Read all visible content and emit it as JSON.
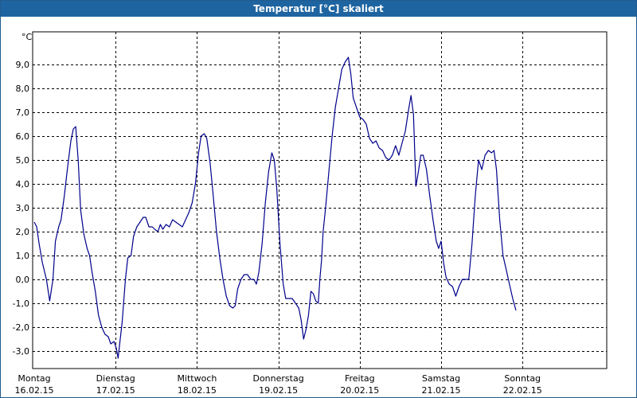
{
  "window": {
    "title": "Temperatur [°C] skaliert"
  },
  "chart_data": {
    "type": "line",
    "title": "Temperatur [°C] skaliert",
    "unit_label": "°C",
    "ylim": [
      -4,
      10
    ],
    "xlim": [
      0,
      7
    ],
    "grid": true,
    "y_ticks": [
      {
        "value": 9,
        "label": "9,0"
      },
      {
        "value": 8,
        "label": "8,0"
      },
      {
        "value": 7,
        "label": "7,0"
      },
      {
        "value": 6,
        "label": "6,0"
      },
      {
        "value": 5,
        "label": "5,0"
      },
      {
        "value": 4,
        "label": "4,0"
      },
      {
        "value": 3,
        "label": "3,0"
      },
      {
        "value": 2,
        "label": "2,0"
      },
      {
        "value": 1,
        "label": "1,0"
      },
      {
        "value": 0,
        "label": "0,0"
      },
      {
        "value": -1,
        "label": "-1,0"
      },
      {
        "value": -2,
        "label": "-2,0"
      },
      {
        "value": -3,
        "label": "-3,0"
      }
    ],
    "x_ticks": [
      {
        "value": 0,
        "day": "Montag",
        "date": "16.02.15"
      },
      {
        "value": 1,
        "day": "Dienstag",
        "date": "17.02.15"
      },
      {
        "value": 2,
        "day": "Mittwoch",
        "date": "18.02.15"
      },
      {
        "value": 3,
        "day": "Donnerstag",
        "date": "19.02.15"
      },
      {
        "value": 4,
        "day": "Freitag",
        "date": "20.02.15"
      },
      {
        "value": 5,
        "day": "Samstag",
        "date": "21.02.15"
      },
      {
        "value": 6,
        "day": "Sonntag",
        "date": "22.02.15"
      }
    ],
    "series": [
      {
        "color": "#00008b",
        "points": [
          [
            0.0,
            2.4
          ],
          [
            0.03,
            2.2
          ],
          [
            0.06,
            1.5
          ],
          [
            0.1,
            0.7
          ],
          [
            0.15,
            0.0
          ],
          [
            0.19,
            -0.9
          ],
          [
            0.23,
            0.0
          ],
          [
            0.26,
            1.6
          ],
          [
            0.3,
            2.2
          ],
          [
            0.33,
            2.5
          ],
          [
            0.37,
            3.5
          ],
          [
            0.41,
            4.7
          ],
          [
            0.45,
            5.8
          ],
          [
            0.48,
            6.3
          ],
          [
            0.51,
            6.4
          ],
          [
            0.54,
            5.0
          ],
          [
            0.57,
            2.9
          ],
          [
            0.61,
            1.9
          ],
          [
            0.65,
            1.3
          ],
          [
            0.68,
            1.0
          ],
          [
            0.71,
            0.3
          ],
          [
            0.75,
            -0.5
          ],
          [
            0.79,
            -1.5
          ],
          [
            0.83,
            -2.0
          ],
          [
            0.87,
            -2.3
          ],
          [
            0.91,
            -2.4
          ],
          [
            0.94,
            -2.7
          ],
          [
            0.98,
            -2.6
          ],
          [
            1.01,
            -2.9
          ],
          [
            1.03,
            -3.3
          ],
          [
            1.05,
            -2.7
          ],
          [
            1.08,
            -1.8
          ],
          [
            1.12,
            0.0
          ],
          [
            1.15,
            0.9
          ],
          [
            1.19,
            1.0
          ],
          [
            1.22,
            1.8
          ],
          [
            1.26,
            2.2
          ],
          [
            1.3,
            2.4
          ],
          [
            1.34,
            2.6
          ],
          [
            1.37,
            2.6
          ],
          [
            1.41,
            2.2
          ],
          [
            1.45,
            2.2
          ],
          [
            1.48,
            2.1
          ],
          [
            1.52,
            2.0
          ],
          [
            1.55,
            2.3
          ],
          [
            1.58,
            2.1
          ],
          [
            1.62,
            2.3
          ],
          [
            1.66,
            2.2
          ],
          [
            1.7,
            2.5
          ],
          [
            1.74,
            2.4
          ],
          [
            1.78,
            2.3
          ],
          [
            1.82,
            2.2
          ],
          [
            1.86,
            2.5
          ],
          [
            1.9,
            2.8
          ],
          [
            1.94,
            3.2
          ],
          [
            1.98,
            4.0
          ],
          [
            2.02,
            5.3
          ],
          [
            2.05,
            6.0
          ],
          [
            2.09,
            6.1
          ],
          [
            2.12,
            5.9
          ],
          [
            2.16,
            4.9
          ],
          [
            2.2,
            3.5
          ],
          [
            2.24,
            2.0
          ],
          [
            2.28,
            0.9
          ],
          [
            2.32,
            0.0
          ],
          [
            2.36,
            -0.7
          ],
          [
            2.4,
            -1.1
          ],
          [
            2.44,
            -1.2
          ],
          [
            2.47,
            -1.1
          ],
          [
            2.5,
            -0.4
          ],
          [
            2.54,
            0.0
          ],
          [
            2.58,
            0.2
          ],
          [
            2.62,
            0.2
          ],
          [
            2.66,
            0.0
          ],
          [
            2.7,
            0.0
          ],
          [
            2.73,
            -0.2
          ],
          [
            2.76,
            0.3
          ],
          [
            2.8,
            1.5
          ],
          [
            2.84,
            3.2
          ],
          [
            2.88,
            4.5
          ],
          [
            2.92,
            5.3
          ],
          [
            2.95,
            5.0
          ],
          [
            2.98,
            3.8
          ],
          [
            3.02,
            1.5
          ],
          [
            3.06,
            -0.2
          ],
          [
            3.09,
            -0.8
          ],
          [
            3.13,
            -0.8
          ],
          [
            3.17,
            -0.8
          ],
          [
            3.21,
            -1.0
          ],
          [
            3.25,
            -1.2
          ],
          [
            3.28,
            -1.7
          ],
          [
            3.31,
            -2.5
          ],
          [
            3.34,
            -2.1
          ],
          [
            3.37,
            -1.5
          ],
          [
            3.4,
            -0.5
          ],
          [
            3.43,
            -0.6
          ],
          [
            3.46,
            -0.9
          ],
          [
            3.49,
            -1.0
          ],
          [
            3.51,
            0.0
          ],
          [
            3.53,
            0.8
          ],
          [
            3.55,
            2.0
          ],
          [
            3.58,
            3.0
          ],
          [
            3.62,
            4.5
          ],
          [
            3.66,
            6.0
          ],
          [
            3.7,
            7.2
          ],
          [
            3.74,
            8.0
          ],
          [
            3.78,
            8.8
          ],
          [
            3.82,
            9.1
          ],
          [
            3.86,
            9.3
          ],
          [
            3.89,
            8.6
          ],
          [
            3.92,
            7.6
          ],
          [
            3.96,
            7.2
          ],
          [
            4.0,
            6.8
          ],
          [
            4.04,
            6.7
          ],
          [
            4.08,
            6.5
          ],
          [
            4.12,
            5.9
          ],
          [
            4.16,
            5.7
          ],
          [
            4.2,
            5.8
          ],
          [
            4.24,
            5.5
          ],
          [
            4.28,
            5.4
          ],
          [
            4.32,
            5.1
          ],
          [
            4.36,
            5.0
          ],
          [
            4.4,
            5.2
          ],
          [
            4.44,
            5.6
          ],
          [
            4.48,
            5.2
          ],
          [
            4.52,
            5.7
          ],
          [
            4.56,
            6.2
          ],
          [
            4.6,
            7.1
          ],
          [
            4.63,
            7.7
          ],
          [
            4.66,
            6.9
          ],
          [
            4.69,
            3.9
          ],
          [
            4.72,
            4.5
          ],
          [
            4.75,
            5.2
          ],
          [
            4.78,
            5.2
          ],
          [
            4.82,
            4.6
          ],
          [
            4.86,
            3.5
          ],
          [
            4.9,
            2.5
          ],
          [
            4.94,
            1.6
          ],
          [
            4.97,
            1.3
          ],
          [
            5.0,
            1.6
          ],
          [
            5.03,
            0.7
          ],
          [
            5.06,
            0.1
          ],
          [
            5.1,
            -0.2
          ],
          [
            5.14,
            -0.3
          ],
          [
            5.18,
            -0.7
          ],
          [
            5.22,
            -0.3
          ],
          [
            5.26,
            0.0
          ],
          [
            5.3,
            0.0
          ],
          [
            5.34,
            0.0
          ],
          [
            5.38,
            1.5
          ],
          [
            5.42,
            3.5
          ],
          [
            5.46,
            5.0
          ],
          [
            5.5,
            4.6
          ],
          [
            5.54,
            5.2
          ],
          [
            5.58,
            5.4
          ],
          [
            5.62,
            5.3
          ],
          [
            5.65,
            5.4
          ],
          [
            5.68,
            4.6
          ],
          [
            5.72,
            2.5
          ],
          [
            5.76,
            1.0
          ],
          [
            5.8,
            0.4
          ],
          [
            5.84,
            -0.2
          ],
          [
            5.88,
            -0.8
          ],
          [
            5.92,
            -1.3
          ]
        ]
      }
    ]
  }
}
